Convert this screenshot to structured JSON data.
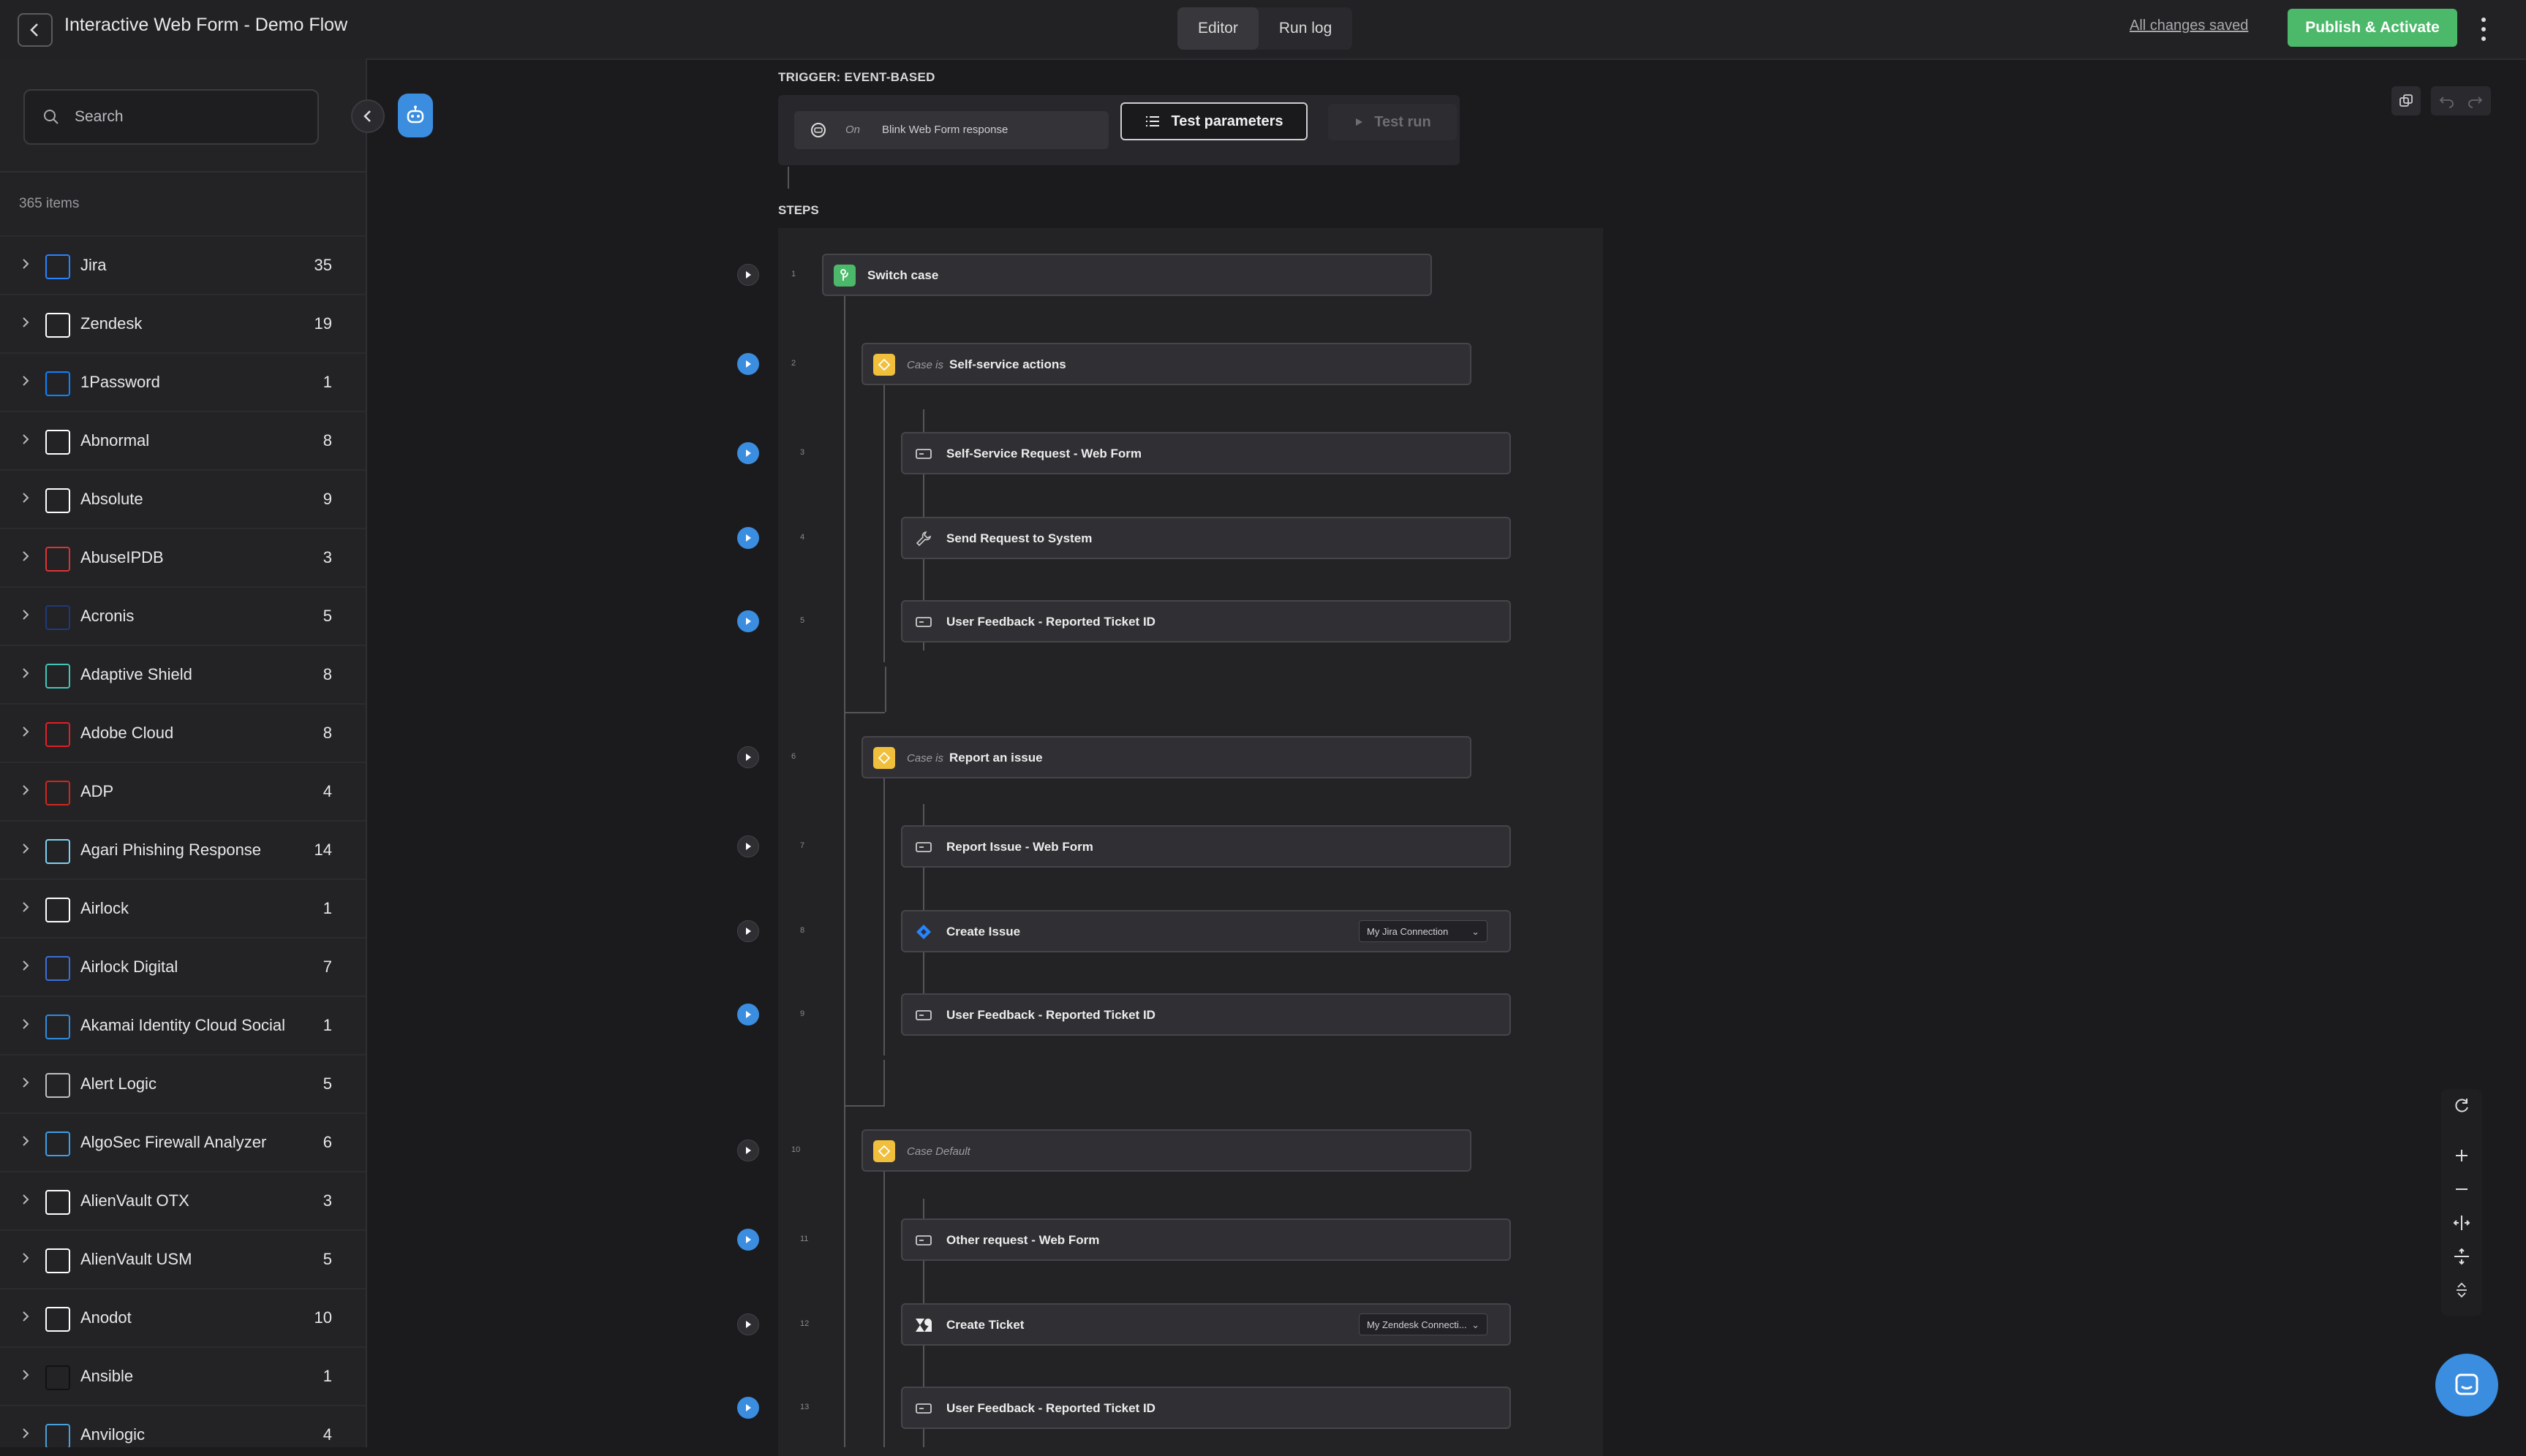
{
  "header": {
    "title": "Interactive Web Form - Demo Flow",
    "tabs": [
      {
        "label": "Editor",
        "active": true
      },
      {
        "label": "Run log",
        "active": false
      }
    ],
    "save_status": "All changes saved",
    "publish_label": "Publish & Activate"
  },
  "sidebar": {
    "search_placeholder": "Search",
    "items_count": "365 items",
    "items": [
      {
        "label": "Jira",
        "count": "35",
        "icon": "jira-icon",
        "color": "#2684ff"
      },
      {
        "label": "Zendesk",
        "count": "19",
        "icon": "zendesk-icon",
        "color": "#ffffff"
      },
      {
        "label": "1Password",
        "count": "1",
        "icon": "1password-icon",
        "color": "#0a84ff"
      },
      {
        "label": "Abnormal",
        "count": "8",
        "icon": "abnormal-icon",
        "color": "#ffffff"
      },
      {
        "label": "Absolute",
        "count": "9",
        "icon": "absolute-icon",
        "color": "#ffffff"
      },
      {
        "label": "AbuseIPDB",
        "count": "3",
        "icon": "abuseipdb-icon",
        "color": "#d33"
      },
      {
        "label": "Acronis",
        "count": "5",
        "icon": "acronis-icon",
        "color": "#1e3a7a"
      },
      {
        "label": "Adaptive Shield",
        "count": "8",
        "icon": "adaptive-shield-icon",
        "color": "#3fc6b8"
      },
      {
        "label": "Adobe Cloud",
        "count": "8",
        "icon": "adobe-icon",
        "color": "#e01f26"
      },
      {
        "label": "ADP",
        "count": "4",
        "icon": "adp-icon",
        "color": "#d0271d"
      },
      {
        "label": "Agari Phishing Response",
        "count": "14",
        "icon": "agari-icon",
        "color": "#7fd0f0"
      },
      {
        "label": "Airlock",
        "count": "1",
        "icon": "airlock-icon",
        "color": "#ffffff"
      },
      {
        "label": "Airlock Digital",
        "count": "7",
        "icon": "airlock-digital-icon",
        "color": "#3b6fd8"
      },
      {
        "label": "Akamai Identity Cloud Social",
        "count": "1",
        "icon": "akamai-icon",
        "color": "#2e8ce0"
      },
      {
        "label": "Alert Logic",
        "count": "5",
        "icon": "alert-logic-icon",
        "color": "#c0c0c0"
      },
      {
        "label": "AlgoSec Firewall Analyzer",
        "count": "6",
        "icon": "algosec-icon",
        "color": "#3aa0e8"
      },
      {
        "label": "AlienVault OTX",
        "count": "3",
        "icon": "alien-icon",
        "color": "#ffffff"
      },
      {
        "label": "AlienVault USM",
        "count": "5",
        "icon": "alien-icon",
        "color": "#ffffff"
      },
      {
        "label": "Anodot",
        "count": "10",
        "icon": "anodot-icon",
        "color": "#ffffff"
      },
      {
        "label": "Ansible",
        "count": "1",
        "icon": "ansible-icon",
        "color": "#111111"
      },
      {
        "label": "Anvilogic",
        "count": "4",
        "icon": "anvilogic-icon",
        "color": "#4aa0d8"
      }
    ]
  },
  "trigger": {
    "section_label": "TRIGGER: EVENT-BASED",
    "prefix": "On",
    "text": "Blink Web Form response",
    "test_params_label": "Test parameters",
    "test_run_label": "Test run"
  },
  "steps": {
    "section_label": "STEPS",
    "items": [
      {
        "num": "1",
        "kind": "switch",
        "label": "Switch case",
        "play": "dark"
      },
      {
        "num": "2",
        "kind": "case",
        "cond": "Case is",
        "label": "Self-service actions",
        "play": "blue"
      },
      {
        "num": "3",
        "kind": "form",
        "label": "Self-Service Request - Web Form",
        "play": "blue"
      },
      {
        "num": "4",
        "kind": "wrench",
        "label": "Send Request to System",
        "play": "blue"
      },
      {
        "num": "5",
        "kind": "form",
        "label": "User Feedback - Reported Ticket ID",
        "play": "blue"
      },
      {
        "num": "6",
        "kind": "case",
        "cond": "Case is",
        "label": "Report an issue",
        "play": "dark"
      },
      {
        "num": "7",
        "kind": "form",
        "label": "Report Issue - Web Form",
        "play": "dark"
      },
      {
        "num": "8",
        "kind": "jira",
        "label": "Create Issue",
        "connection": "My Jira Connection",
        "play": "dark"
      },
      {
        "num": "9",
        "kind": "form",
        "label": "User Feedback - Reported Ticket ID",
        "play": "blue"
      },
      {
        "num": "10",
        "kind": "case",
        "cond": "Case Default",
        "label": "",
        "play": "dark"
      },
      {
        "num": "11",
        "kind": "form",
        "label": "Other request - Web Form",
        "play": "blue"
      },
      {
        "num": "12",
        "kind": "zendesk",
        "label": "Create Ticket",
        "connection": "My Zendesk Connecti...",
        "play": "dark"
      },
      {
        "num": "13",
        "kind": "form",
        "label": "User Feedback - Reported Ticket ID",
        "play": "blue"
      }
    ]
  }
}
